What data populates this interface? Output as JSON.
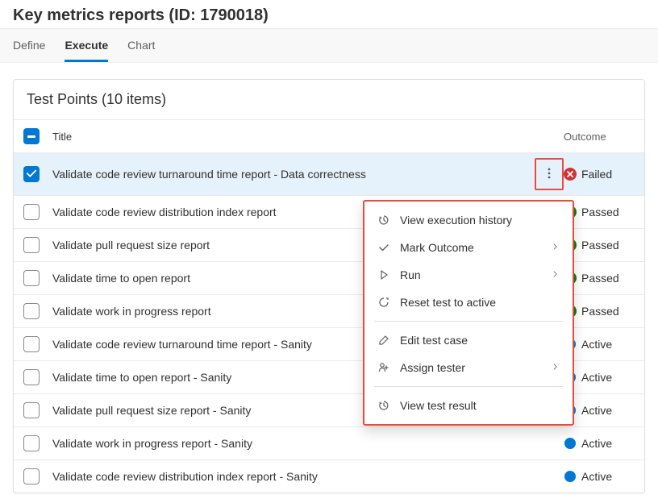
{
  "header": {
    "title": "Key metrics reports (ID: 1790018)"
  },
  "tabs": [
    {
      "label": "Define",
      "active": false
    },
    {
      "label": "Execute",
      "active": true
    },
    {
      "label": "Chart",
      "active": false
    }
  ],
  "panel": {
    "title": "Test Points (10 items)",
    "columns": {
      "title": "Title",
      "outcome": "Outcome"
    }
  },
  "rows": [
    {
      "title": "Validate code review turnaround time report - Data correctness",
      "outcome": "Failed",
      "status": "fail",
      "selected": true,
      "showKebab": true
    },
    {
      "title": "Validate code review distribution index report",
      "outcome": "Passed",
      "status": "pass",
      "selected": false
    },
    {
      "title": "Validate pull request size report",
      "outcome": "Passed",
      "status": "pass",
      "selected": false
    },
    {
      "title": "Validate time to open report",
      "outcome": "Passed",
      "status": "pass",
      "selected": false
    },
    {
      "title": "Validate work in progress report",
      "outcome": "Passed",
      "status": "pass",
      "selected": false
    },
    {
      "title": "Validate code review turnaround time report - Sanity",
      "outcome": "Active",
      "status": "active",
      "selected": false
    },
    {
      "title": "Validate time to open report - Sanity",
      "outcome": "Active",
      "status": "active",
      "selected": false
    },
    {
      "title": "Validate pull request size report - Sanity",
      "outcome": "Active",
      "status": "active",
      "selected": false
    },
    {
      "title": "Validate work in progress report - Sanity",
      "outcome": "Active",
      "status": "active",
      "selected": false
    },
    {
      "title": "Validate code review distribution index report - Sanity",
      "outcome": "Active",
      "status": "active",
      "selected": false
    }
  ],
  "contextMenu": {
    "sections": [
      [
        {
          "icon": "history",
          "label": "View execution history",
          "submenu": false
        },
        {
          "icon": "check",
          "label": "Mark Outcome",
          "submenu": true
        },
        {
          "icon": "play",
          "label": "Run",
          "submenu": true
        },
        {
          "icon": "reset",
          "label": "Reset test to active",
          "submenu": false
        }
      ],
      [
        {
          "icon": "edit",
          "label": "Edit test case",
          "submenu": false
        },
        {
          "icon": "assign",
          "label": "Assign tester",
          "submenu": true
        }
      ],
      [
        {
          "icon": "history",
          "label": "View test result",
          "submenu": false
        }
      ]
    ]
  }
}
